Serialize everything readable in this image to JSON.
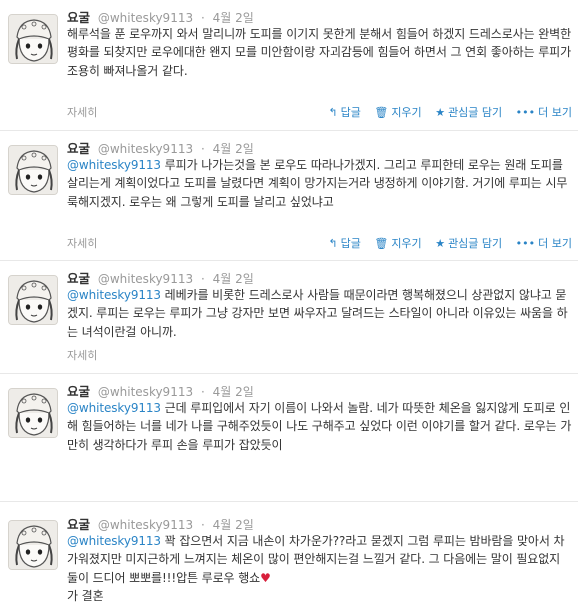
{
  "tweets": [
    {
      "name": "요굴",
      "screen_name": "@whitesky9113",
      "separator": "·",
      "time": "4월 2일",
      "mention": "",
      "text": "해루석을 푼 로우까지 와서 말리니까 도피를 이기지 못한게 분해서 힘들어 하겠지 드레스로사는 완벽한 평화를 되찾지만 로우에대한 왠지 모를 미안함이랑 자괴감등에 힘들어 하면서 그 연회 좋아하는 루피가 조용히 빠져나올거 같다.",
      "expand": "자세히",
      "actions": {
        "reply": "답글",
        "delete": "지우기",
        "favorite": "관심글 담기",
        "more": "더 보기"
      }
    },
    {
      "name": "요굴",
      "screen_name": "@whitesky9113",
      "separator": "·",
      "time": "4월 2일",
      "mention": "@whitesky9113",
      "text": " 루피가 나가는것을 본 로우도 따라나가겠지. 그리고 루피한테 로우는 원래 도피를 살리는게 계획이었다고 도피를 날렸다면 계획이 망가지는거라 냉정하게 이야기함. 거기에 루피는 시무룩해지겠지. 로우는 왜 그렇게 도피를 날리고 싶었냐고",
      "expand": "자세히",
      "actions": {
        "reply": "답글",
        "delete": "지우기",
        "favorite": "관심글 담기",
        "more": "더 보기"
      }
    },
    {
      "name": "요굴",
      "screen_name": "@whitesky9113",
      "separator": "·",
      "time": "4월 2일",
      "mention": "@whitesky9113",
      "text": " 레베카를 비롯한 드레스로사 사람들 때문이라면 행복해졌으니 상관없지 않냐고 묻겠지. 루피는 로우는 루피가 그냥 강자만 보면 싸우자고 달려드는 스타일이 아니라 이유있는 싸움을 하는 녀석이란걸 아니까.",
      "expand": "자세히",
      "actions": {
        "reply": "답글",
        "delete": "지우기",
        "favorite": "관심글 담기",
        "more": "더 보기"
      }
    },
    {
      "name": "요굴",
      "screen_name": "@whitesky9113",
      "separator": "·",
      "time": "4월 2일",
      "mention": "@whitesky9113",
      "text": " 근데 루피입에서 자기 이름이 나와서 놀람. 네가 따뜻한 체온을 잃지않게 도피로 인해 힘들어하는 너를 네가 나를 구해주었듯이 나도 구해주고 싶었다 이런 이야기를 할거 같다. 로우는 가만히 생각하다가 루피 손을 루피가 잡았듯이",
      "expand": "",
      "actions": {
        "reply": "",
        "delete": "",
        "favorite": "",
        "more": ""
      }
    },
    {
      "name": "요굴",
      "screen_name": "@whitesky9113",
      "separator": "·",
      "time": "4월 2일",
      "mention": "@whitesky9113",
      "text": " 꽉 잡으면서 지금 내손이 차가운가??라고 묻겠지 그럼 루피는 밤바람을 맞아서 차가워졌지만 미지근하게 느껴지는 체온이 많이 편안해지는걸 느낄거 같다. 그 다음에는 말이 필요없지 둘이 드디어 뽀뽀를!!!압튼 루로우 행쇼",
      "heart": "♥",
      "tail": "가 결혼",
      "expand": "",
      "actions": {
        "reply": "",
        "delete": "",
        "favorite": "",
        "more": ""
      }
    }
  ],
  "icons": {
    "reply": "reply-arrow-icon",
    "delete": "trash-icon",
    "favorite": "star-icon",
    "more": "ellipsis-icon"
  },
  "colors": {
    "link": "#2a84c6",
    "muted": "#999999",
    "text": "#333333",
    "heart": "#d81f3b"
  }
}
